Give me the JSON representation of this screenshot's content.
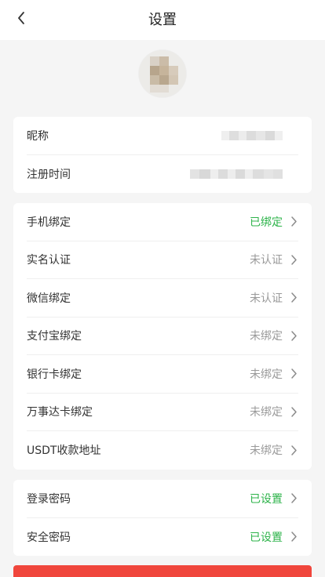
{
  "header": {
    "title": "设置"
  },
  "profile": {
    "nickname_label": "昵称",
    "register_time_label": "注册时间"
  },
  "bindings": [
    {
      "label": "手机绑定",
      "status": "已绑定",
      "status_state": "ok"
    },
    {
      "label": "实名认证",
      "status": "未认证",
      "status_state": "pending"
    },
    {
      "label": "微信绑定",
      "status": "未认证",
      "status_state": "pending"
    },
    {
      "label": "支付宝绑定",
      "status": "未绑定",
      "status_state": "pending"
    },
    {
      "label": "银行卡绑定",
      "status": "未绑定",
      "status_state": "pending"
    },
    {
      "label": "万事达卡绑定",
      "status": "未绑定",
      "status_state": "pending"
    },
    {
      "label": "USDT收款地址",
      "status": "未绑定",
      "status_state": "pending"
    }
  ],
  "security": [
    {
      "label": "登录密码",
      "status": "已设置",
      "status_state": "ok"
    },
    {
      "label": "安全密码",
      "status": "已设置",
      "status_state": "ok"
    }
  ],
  "colors": {
    "status_ok": "#2db34a",
    "status_pending": "#9a9a9a",
    "bottom_button": "#f0463c"
  },
  "icons": {
    "back": "chevron-left-icon",
    "row_arrow": "chevron-right-icon"
  }
}
